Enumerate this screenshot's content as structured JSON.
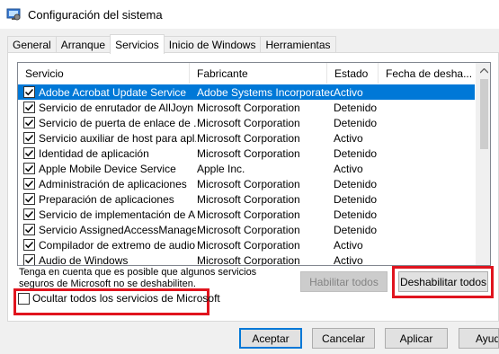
{
  "window": {
    "title": "Configuración del sistema"
  },
  "tabs": [
    {
      "label": "General"
    },
    {
      "label": "Arranque"
    },
    {
      "label": "Servicios"
    },
    {
      "label": "Inicio de Windows"
    },
    {
      "label": "Herramientas"
    }
  ],
  "columns": {
    "servicio": "Servicio",
    "fabricante": "Fabricante",
    "estado": "Estado",
    "fecha": "Fecha de desha..."
  },
  "services": [
    {
      "name": "Adobe Acrobat Update Service",
      "maker": "Adobe Systems Incorporated",
      "status": "Activo",
      "checked": true,
      "selected": true
    },
    {
      "name": "Servicio de enrutador de AllJoyn",
      "maker": "Microsoft Corporation",
      "status": "Detenido",
      "checked": true
    },
    {
      "name": "Servicio de puerta de enlace de ...",
      "maker": "Microsoft Corporation",
      "status": "Detenido",
      "checked": true
    },
    {
      "name": "Servicio auxiliar de host para apl...",
      "maker": "Microsoft Corporation",
      "status": "Activo",
      "checked": true
    },
    {
      "name": "Identidad de aplicación",
      "maker": "Microsoft Corporation",
      "status": "Detenido",
      "checked": true
    },
    {
      "name": "Apple Mobile Device Service",
      "maker": "Apple Inc.",
      "status": "Activo",
      "checked": true
    },
    {
      "name": "Administración de aplicaciones",
      "maker": "Microsoft Corporation",
      "status": "Detenido",
      "checked": true
    },
    {
      "name": "Preparación de aplicaciones",
      "maker": "Microsoft Corporation",
      "status": "Detenido",
      "checked": true
    },
    {
      "name": "Servicio de implementación de A...",
      "maker": "Microsoft Corporation",
      "status": "Detenido",
      "checked": true
    },
    {
      "name": "Servicio AssignedAccessManager",
      "maker": "Microsoft Corporation",
      "status": "Detenido",
      "checked": true
    },
    {
      "name": "Compilador de extremo de audio...",
      "maker": "Microsoft Corporation",
      "status": "Activo",
      "checked": true
    },
    {
      "name": "Audio de Windows",
      "maker": "Microsoft Corporation",
      "status": "Activo",
      "checked": true
    }
  ],
  "note": "Tenga en cuenta que es posible que algunos servicios seguros de Microsoft no se deshabiliten.",
  "buttons": {
    "enable_all": "Habilitar todos",
    "disable_all": "Deshabilitar todos",
    "ok": "Aceptar",
    "cancel": "Cancelar",
    "apply": "Aplicar",
    "help": "Ayuda"
  },
  "hide_ms_label": "Ocultar todos los servicios de Microsoft",
  "colors": {
    "selection": "#0078d7",
    "highlight": "#e0141e"
  }
}
